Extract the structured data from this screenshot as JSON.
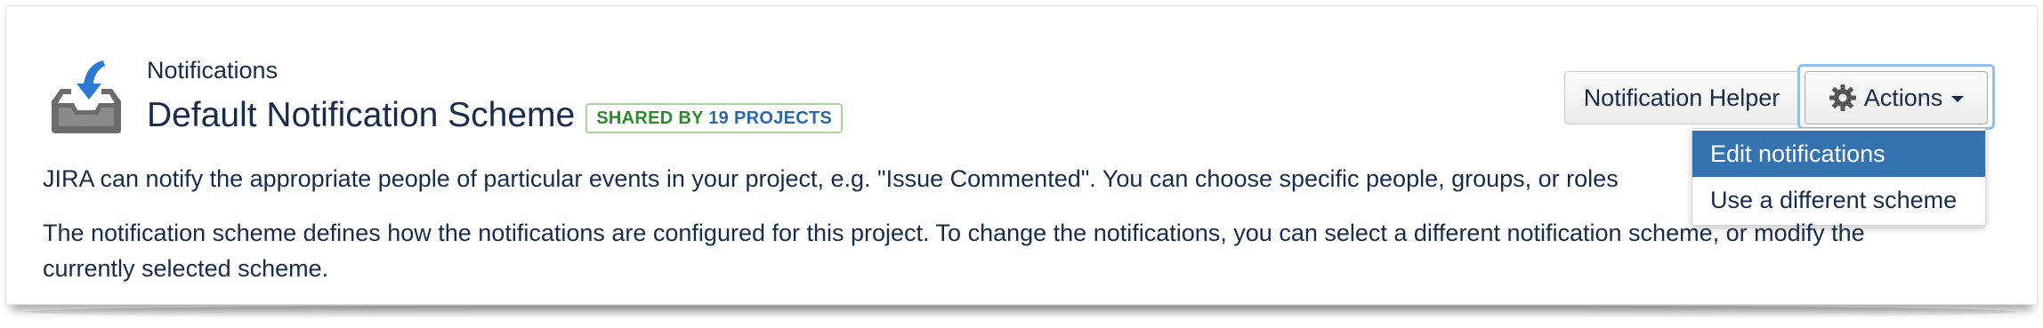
{
  "header": {
    "breadcrumb": "Notifications",
    "title": "Default Notification Scheme",
    "badge": {
      "prefix": "SHARED BY",
      "count": "19",
      "suffix": "PROJECTS"
    },
    "icon": "inbox-download-icon"
  },
  "toolbar": {
    "helper_label": "Notification Helper",
    "actions_label": "Actions",
    "actions_icon": "gear-icon"
  },
  "actions_menu": {
    "items": [
      {
        "label": "Edit notifications",
        "active": true
      },
      {
        "label": "Use a different scheme",
        "active": false
      }
    ]
  },
  "description": {
    "line1": "JIRA can notify the appropriate people of particular events in your project, e.g. \"Issue Commented\". You can choose specific people, groups, or roles",
    "line2": "The notification scheme defines how the notifications are configured for this project. To change the notifications, you can select a different notification scheme, or modify the",
    "line3": "currently selected scheme."
  },
  "colors": {
    "text": "#172b4d",
    "menu_active_bg": "#3572b0",
    "badge_green": "#2c8a2c",
    "badge_blue": "#2a6aa8",
    "focus_ring": "#8fc1f0"
  }
}
